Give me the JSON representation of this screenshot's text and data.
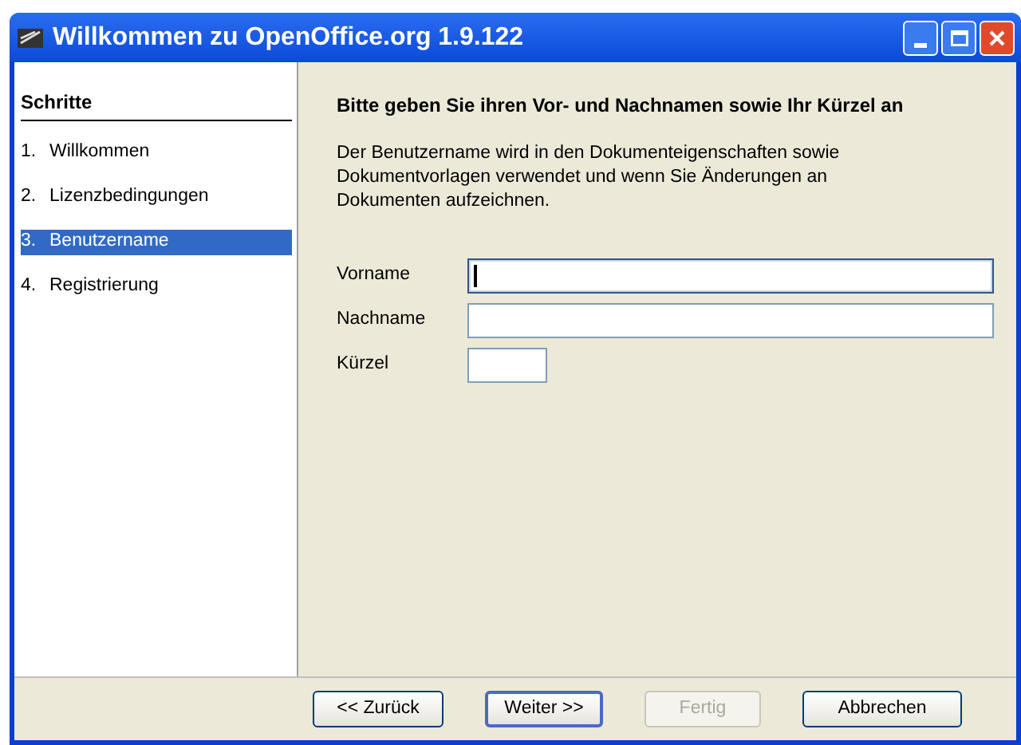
{
  "window": {
    "title": "Willkommen zu OpenOffice.org 1.9.122"
  },
  "sidebar": {
    "title": "Schritte",
    "items": [
      {
        "number": "1.",
        "label": "Willkommen",
        "selected": false
      },
      {
        "number": "2.",
        "label": "Lizenzbedingungen",
        "selected": false
      },
      {
        "number": "3.",
        "label": "Benutzername",
        "selected": true
      },
      {
        "number": "4.",
        "label": "Registrierung",
        "selected": false
      }
    ]
  },
  "content": {
    "heading": "Bitte geben Sie ihren Vor- und Nachnamen sowie Ihr Kürzel an",
    "description": "Der Benutzername wird in den Dokumenteigenschaften sowie Dokumentvorlagen verwendet und wenn Sie Änderungen an Dokumenten aufzeichnen.",
    "fields": [
      {
        "label": "Vorname",
        "kind": "wide",
        "focused": true
      },
      {
        "label": "Nachname",
        "kind": "wide",
        "focused": false
      },
      {
        "label": "Kürzel",
        "kind": "short",
        "focused": false
      }
    ]
  },
  "buttons": [
    {
      "label": "<< Zurück",
      "default": false,
      "disabled": false
    },
    {
      "label": "Weiter >>",
      "default": true,
      "disabled": false
    },
    {
      "label": "Fertig",
      "default": false,
      "disabled": true
    },
    {
      "label": "Abbrechen",
      "default": false,
      "disabled": false
    }
  ]
}
